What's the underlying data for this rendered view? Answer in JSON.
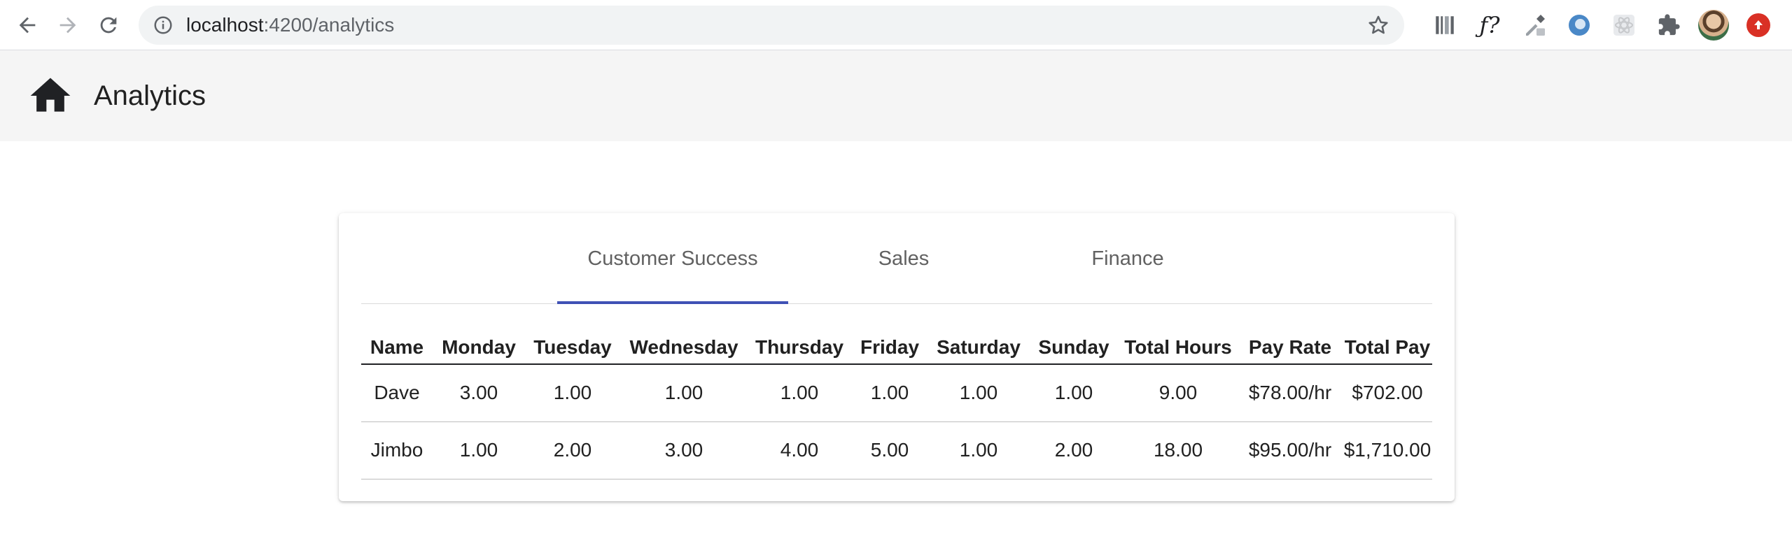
{
  "browser": {
    "url_host": "localhost",
    "url_path": ":4200/analytics"
  },
  "toolbar": {
    "title": "Analytics",
    "home_icon": "home-icon"
  },
  "tabs": [
    {
      "label": "Customer Success",
      "active": true
    },
    {
      "label": "Sales",
      "active": false
    },
    {
      "label": "Finance",
      "active": false
    }
  ],
  "table": {
    "headers": [
      "Name",
      "Monday",
      "Tuesday",
      "Wednesday",
      "Thursday",
      "Friday",
      "Saturday",
      "Sunday",
      "Total Hours",
      "Pay Rate",
      "Total Pay"
    ],
    "rows": [
      [
        "Dave",
        "3.00",
        "1.00",
        "1.00",
        "1.00",
        "1.00",
        "1.00",
        "1.00",
        "9.00",
        "$78.00/hr",
        "$702.00"
      ],
      [
        "Jimbo",
        "1.00",
        "2.00",
        "3.00",
        "4.00",
        "5.00",
        "1.00",
        "2.00",
        "18.00",
        "$95.00/hr",
        "$1,710.00"
      ]
    ]
  },
  "colors": {
    "tab_ink": "#3f51b5",
    "toolbar_bg": "#f5f5f5"
  }
}
